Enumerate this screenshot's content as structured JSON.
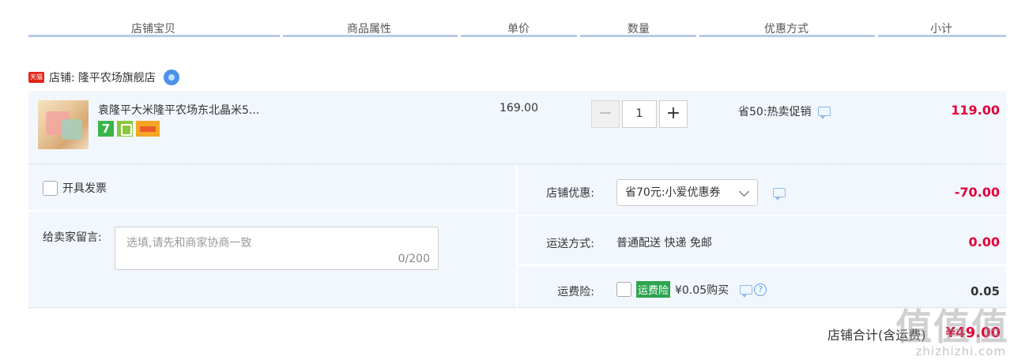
{
  "header": {
    "col_shop_item": "店铺宝贝",
    "col_attributes": "商品属性",
    "col_unit_price": "单价",
    "col_quantity": "数量",
    "col_discount": "优惠方式",
    "col_subtotal": "小计"
  },
  "shop": {
    "badge": "天猫",
    "label": "店铺:",
    "name": "隆平农场旗舰店"
  },
  "item": {
    "name": "袁隆平大米隆平农场东北晶米5...",
    "badge_seven": "7",
    "unit_price": "169.00",
    "quantity": "1",
    "minus": "−",
    "plus": "+",
    "promotion": "省50:热卖促销",
    "subtotal": "119.00"
  },
  "options": {
    "invoice_label": "开具发票",
    "message_label": "给卖家留言:",
    "message_placeholder": "选填,请先和商家协商一致",
    "message_count": "0/200",
    "shop_discount_label": "店铺优惠:",
    "shop_discount_value": "省70元:小爱优惠券",
    "shop_discount_amount": "-70.00",
    "shipping_label": "运送方式:",
    "shipping_value": "普通配送 快递 免邮",
    "shipping_amount": "0.00",
    "insurance_label": "运费险:",
    "insurance_tag": "运费险",
    "insurance_price": "¥0.05购买",
    "insurance_amount": "0.05"
  },
  "total": {
    "label": "店铺合计(含运费)",
    "value": "¥49.00"
  },
  "watermark": {
    "text": "值值值",
    "site": "zhizhizhi.com"
  },
  "colors": {
    "accent_red": "#e4003a",
    "row_bg": "#f2f7fd",
    "header_line": "#b8cbe6"
  }
}
